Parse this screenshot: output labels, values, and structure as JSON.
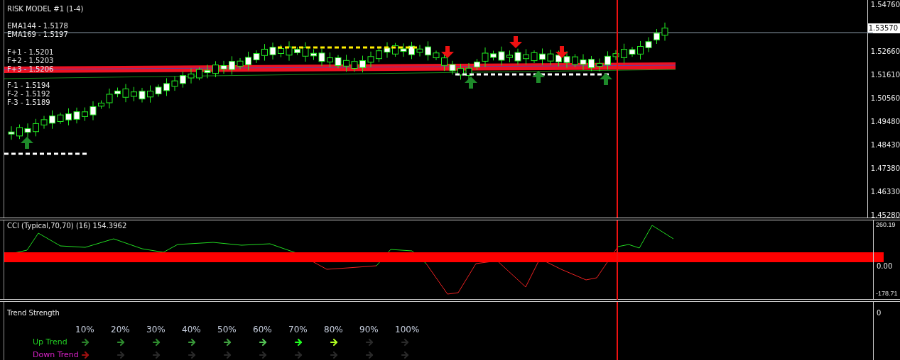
{
  "main_chart": {
    "title": "RISK MODEL #1 (1-4)",
    "legend": [
      "EMA144 - 1.5178",
      "EMA169 - 1.5197"
    ],
    "levels_up": [
      "F+1 - 1.5201",
      "F+2 - 1.5203",
      "F+3 - 1.5206"
    ],
    "levels_down": [
      "F-1 - 1.5194",
      "F-2 - 1.5192",
      "F-3 - 1.5189"
    ],
    "price_axis": [
      {
        "text": "1.54760",
        "kind": "tick"
      },
      {
        "text": "1.53570",
        "kind": "current"
      },
      {
        "text": "1.52660",
        "kind": "tick"
      },
      {
        "text": "1.51610",
        "kind": "tick"
      },
      {
        "text": "1.50560",
        "kind": "tick"
      },
      {
        "text": "1.49480",
        "kind": "tick"
      },
      {
        "text": "1.48430",
        "kind": "tick"
      },
      {
        "text": "1.47380",
        "kind": "tick"
      },
      {
        "text": "1.46330",
        "kind": "tick"
      },
      {
        "text": "1.45280",
        "kind": "tick"
      }
    ]
  },
  "cci": {
    "title": "CCI (Typical,70,70) (16) 154.3962",
    "axis": [
      "260.19",
      "0.00",
      "-178.71"
    ]
  },
  "trend_strength": {
    "title": "Trend Strength",
    "axis": "0",
    "columns": [
      "10%",
      "20%",
      "30%",
      "40%",
      "50%",
      "60%",
      "70%",
      "80%",
      "90%",
      "100%"
    ],
    "rows": [
      {
        "label": "Up Trend",
        "color": "#22cc22",
        "arrows": [
          {
            "color": "#2a7f2a"
          },
          {
            "color": "#2e8b2e"
          },
          {
            "color": "#2e8b2e"
          },
          {
            "color": "#3a9a3a"
          },
          {
            "color": "#40a040"
          },
          {
            "color": "#55c455"
          },
          {
            "color": "#22ff22"
          },
          {
            "color": "#b0ff22"
          },
          {
            "color": "#2a2a2a"
          },
          {
            "color": "#2a2a2a"
          }
        ]
      },
      {
        "label": "Down Trend",
        "color": "#dd22cc",
        "arrows": [
          {
            "color": "#a01010"
          },
          {
            "color": "#2a2a2a"
          },
          {
            "color": "#2a2a2a"
          },
          {
            "color": "#2a2a2a"
          },
          {
            "color": "#2a2a2a"
          },
          {
            "color": "#2a2a2a"
          },
          {
            "color": "#2a2a2a"
          },
          {
            "color": "#2a2a2a"
          },
          {
            "color": "#2a2a2a"
          },
          {
            "color": "#2a2a2a"
          }
        ]
      }
    ]
  }
}
